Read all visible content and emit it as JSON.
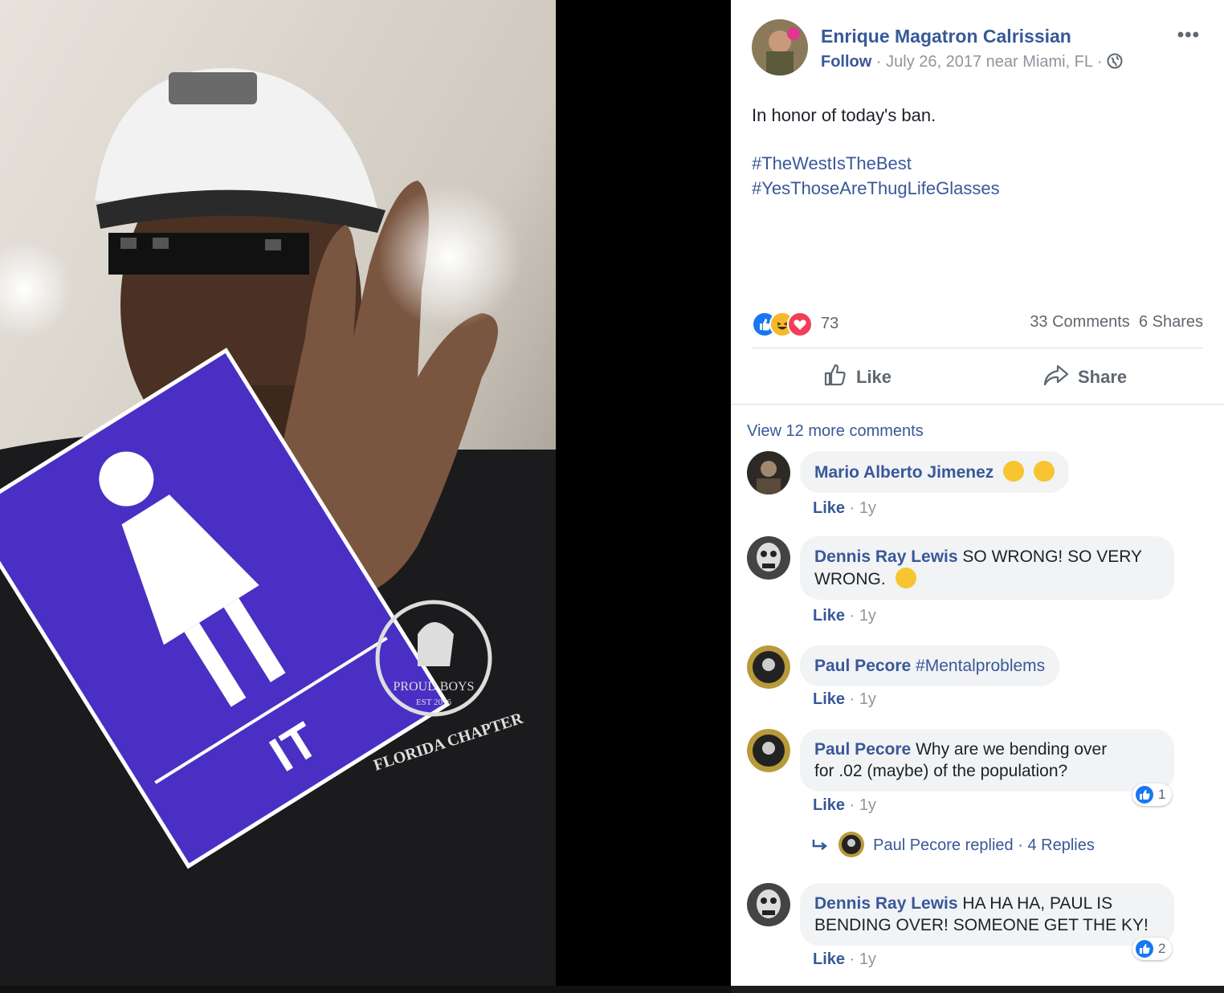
{
  "photo": {
    "sign_text": "IT",
    "shirt_text": "PROUD BOYS",
    "shirt_sub": "FLORIDA CHAPTER",
    "shirt_est": "EST 2016"
  },
  "post": {
    "author": "Enrique Magatron Calrissian",
    "follow": "Follow",
    "date": "July 26, 2017 near Miami, FL",
    "separator": "·",
    "text": "In honor of today's ban.",
    "hashtags": [
      "#TheWestIsTheBest",
      "#YesThoseAreThugLifeGlasses"
    ],
    "reaction_count": "73",
    "comments_count": "33 Comments",
    "shares_count": "6 Shares",
    "like_label": "Like",
    "share_label": "Share",
    "more": "•••"
  },
  "comments_section": {
    "view_more": "View 12 more comments",
    "comments": [
      {
        "name": "Mario Alberto Jimenez",
        "text": "",
        "like": "Like",
        "time": "1y"
      },
      {
        "name": "Dennis Ray Lewis",
        "text": "SO WRONG! SO VERY",
        "text2": "WRONG.",
        "like": "Like",
        "time": "1y"
      },
      {
        "name": "Paul Pecore",
        "text": "#Mentalproblems",
        "like": "Like",
        "time": "1y"
      },
      {
        "name": "Paul Pecore",
        "text": "Why are we bending over",
        "text2": "for .02 (maybe) of the population?",
        "like": "Like",
        "time": "1y",
        "reactions": "1"
      },
      {
        "name": "Dennis Ray Lewis",
        "text": "HA HA HA, PAUL IS",
        "text2": "BENDING OVER! SOMEONE GET THE KY!",
        "like": "Like",
        "time": "1y",
        "reactions": "2"
      }
    ],
    "reply": {
      "text": "Paul Pecore replied",
      "count": "4 Replies"
    }
  },
  "colors": {
    "link": "#385898",
    "muted": "#90949c",
    "sign": "#4a2fc4"
  }
}
